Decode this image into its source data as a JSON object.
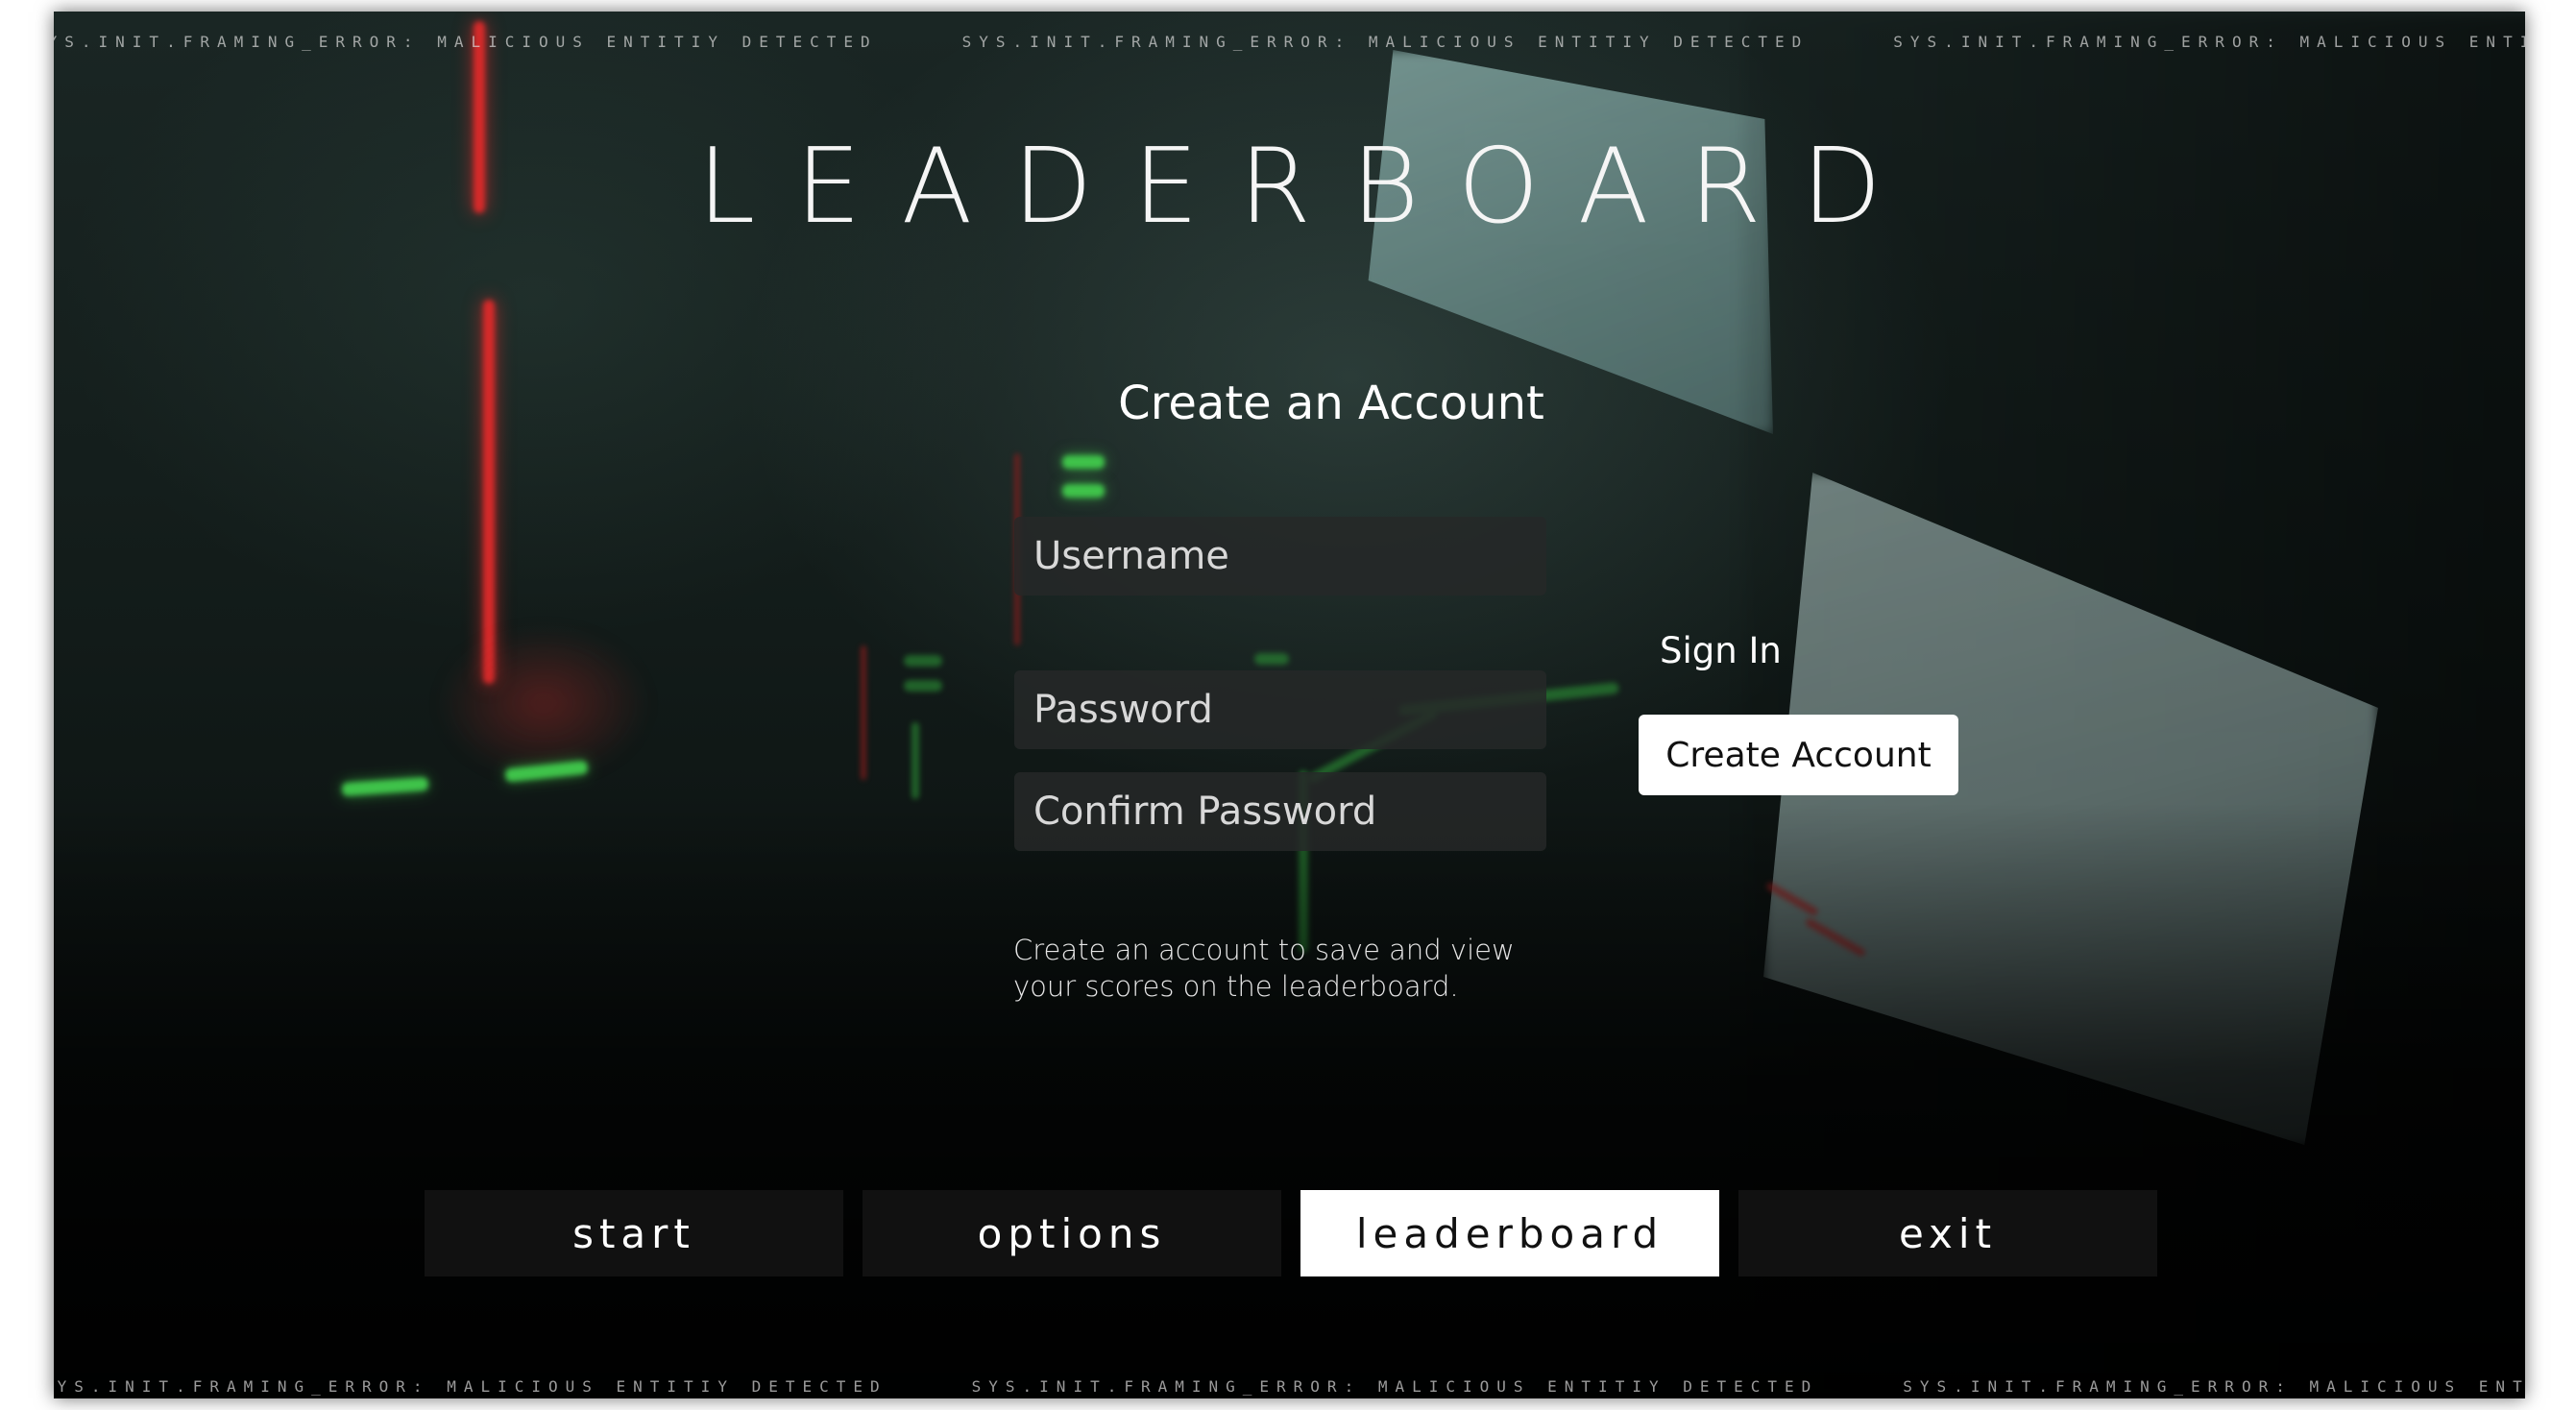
{
  "marquee": {
    "text": "SYS.INIT.FRAMING_ERROR: MALICIOUS ENTITIY DETECTED"
  },
  "title": "LEADERBOARD",
  "form": {
    "heading": "Create an Account",
    "username_placeholder": "Username",
    "password_placeholder": "Password",
    "confirm_placeholder": "Confirm Password",
    "help_text": "Create an account to save and view your scores on the leaderboard."
  },
  "actions": {
    "sign_in_label": "Sign In",
    "create_account_label": "Create Account"
  },
  "nav": {
    "items": [
      {
        "label": "start",
        "active": false
      },
      {
        "label": "options",
        "active": false
      },
      {
        "label": "leaderboard",
        "active": true
      },
      {
        "label": "exit",
        "active": false
      }
    ]
  },
  "colors": {
    "accent_laser_red": "#d62a2a",
    "accent_laser_green": "#3fc34a",
    "active_nav_bg": "#ffffff",
    "nav_bg": "#111111"
  }
}
